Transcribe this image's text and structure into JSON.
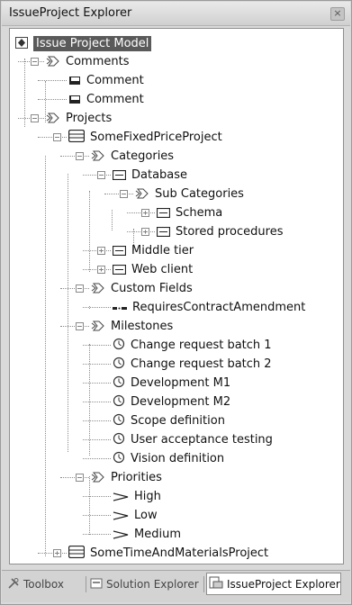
{
  "window": {
    "title": "IssueProject Explorer",
    "close_label": "×"
  },
  "tree": [
    {
      "label": "Issue Project Model",
      "icon": "model-icon",
      "exp": null,
      "root": true
    },
    {
      "label": "Comments",
      "icon": "category-icon",
      "exp": "minus"
    },
    {
      "label": "Comment",
      "icon": "comment-icon",
      "exp": null
    },
    {
      "label": "Comment",
      "icon": "comment-icon",
      "exp": null
    },
    {
      "label": "Projects",
      "icon": "category-icon",
      "exp": "minus"
    },
    {
      "label": "SomeFixedPriceProject",
      "icon": "project-icon",
      "exp": "minus"
    },
    {
      "label": "Categories",
      "icon": "category-icon",
      "exp": "minus"
    },
    {
      "label": "Database",
      "icon": "category-item-icon",
      "exp": "minus"
    },
    {
      "label": "Sub Categories",
      "icon": "category-icon",
      "exp": "minus"
    },
    {
      "label": "Schema",
      "icon": "category-item-icon",
      "exp": "plus"
    },
    {
      "label": "Stored procedures",
      "icon": "category-item-icon",
      "exp": "plus"
    },
    {
      "label": "Middle tier",
      "icon": "category-item-icon",
      "exp": "plus"
    },
    {
      "label": "Web client",
      "icon": "category-item-icon",
      "exp": "plus"
    },
    {
      "label": "Custom Fields",
      "icon": "category-icon",
      "exp": "minus"
    },
    {
      "label": "RequiresContractAmendment",
      "icon": "field-icon",
      "exp": null
    },
    {
      "label": "Milestones",
      "icon": "category-icon",
      "exp": "minus"
    },
    {
      "label": "Change request batch 1",
      "icon": "clock-icon",
      "exp": null
    },
    {
      "label": "Change request batch 2",
      "icon": "clock-icon",
      "exp": null
    },
    {
      "label": "Development M1",
      "icon": "clock-icon",
      "exp": null
    },
    {
      "label": "Development M2",
      "icon": "clock-icon",
      "exp": null
    },
    {
      "label": "Scope definition",
      "icon": "clock-icon",
      "exp": null
    },
    {
      "label": "User acceptance testing",
      "icon": "clock-icon",
      "exp": null
    },
    {
      "label": "Vision definition",
      "icon": "clock-icon",
      "exp": null
    },
    {
      "label": "Priorities",
      "icon": "category-icon",
      "exp": "minus"
    },
    {
      "label": "High",
      "icon": "priority-icon",
      "exp": null
    },
    {
      "label": "Low",
      "icon": "priority-icon",
      "exp": null
    },
    {
      "label": "Medium",
      "icon": "priority-icon",
      "exp": null
    },
    {
      "label": "SomeTimeAndMaterialsProject",
      "icon": "project-icon",
      "exp": "plus"
    }
  ],
  "tabs": [
    {
      "label": "Toolbox",
      "icon": "toolbox-icon",
      "active": false
    },
    {
      "label": "Solution Explorer",
      "icon": "solution-explorer-icon",
      "active": false
    },
    {
      "label": "IssueProject Explorer",
      "icon": "issueproject-explorer-icon",
      "active": true
    }
  ]
}
